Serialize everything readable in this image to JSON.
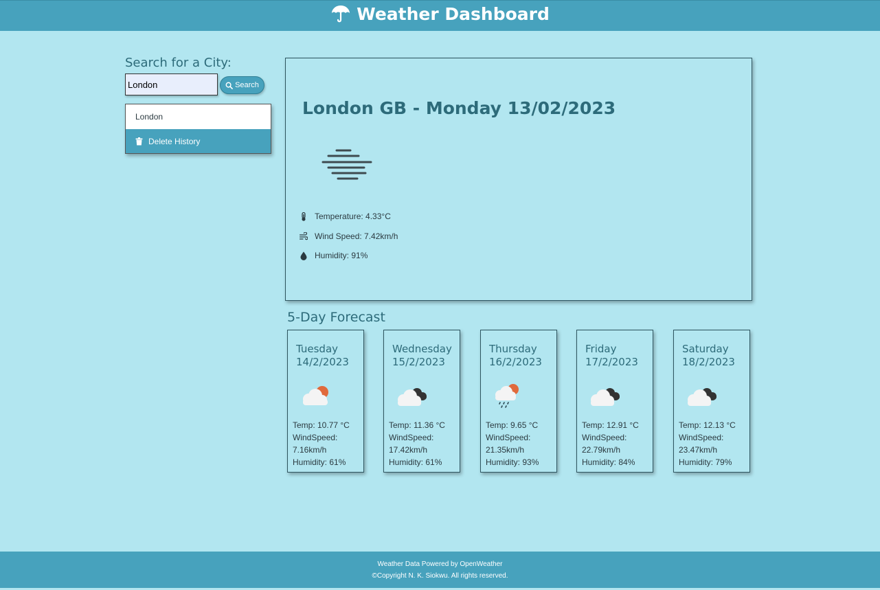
{
  "header": {
    "title": "Weather Dashboard",
    "icon": "umbrella-icon"
  },
  "search": {
    "heading": "Search for a City:",
    "input_value": "London",
    "button_label": "Search",
    "button_icon": "search-icon"
  },
  "history": {
    "items": [
      "London"
    ],
    "delete_label": "Delete History",
    "delete_icon": "trash-icon"
  },
  "current": {
    "title": "London GB - Monday 13/02/2023",
    "icon": "mist-icon",
    "temperature": "Temperature: 4.33°C",
    "wind": "Wind Speed: 7.42km/h",
    "humidity": "Humidity: 91%"
  },
  "forecast": {
    "heading": "5-Day Forecast",
    "days": [
      {
        "day": "Tuesday",
        "date": "14/2/2023",
        "icon": "cloud-sun-icon",
        "temp": "Temp: 10.77 °C",
        "wind_label": "WindSpeed:",
        "wind": "7.16km/h",
        "humidity": "Humidity: 61%"
      },
      {
        "day": "Wednesday",
        "date": "15/2/2023",
        "icon": "broken-clouds-icon",
        "temp": "Temp: 11.36 °C",
        "wind_label": "WindSpeed:",
        "wind": "17.42km/h",
        "humidity": "Humidity: 61%"
      },
      {
        "day": "Thursday",
        "date": "16/2/2023",
        "icon": "rain-sun-icon",
        "temp": "Temp: 9.65 °C",
        "wind_label": "WindSpeed:",
        "wind": "21.35km/h",
        "humidity": "Humidity: 93%"
      },
      {
        "day": "Friday",
        "date": "17/2/2023",
        "icon": "broken-clouds-icon",
        "temp": "Temp: 12.91 °C",
        "wind_label": "WindSpeed:",
        "wind": "22.79km/h",
        "humidity": "Humidity: 84%"
      },
      {
        "day": "Saturday",
        "date": "18/2/2023",
        "icon": "broken-clouds-icon",
        "temp": "Temp: 12.13 °C",
        "wind_label": "WindSpeed:",
        "wind": "23.47km/h",
        "humidity": "Humidity: 79%"
      }
    ]
  },
  "footer": {
    "line1": "Weather Data Powered by OpenWeather",
    "line2": "©Copyright N. K. Siokwu. All rights reserved."
  },
  "colors": {
    "background": "#b2e6f0",
    "accent": "#47a2bd",
    "heading_text": "#2d6b7a",
    "sun": "#e06a3c",
    "dark_cloud": "#333333"
  }
}
